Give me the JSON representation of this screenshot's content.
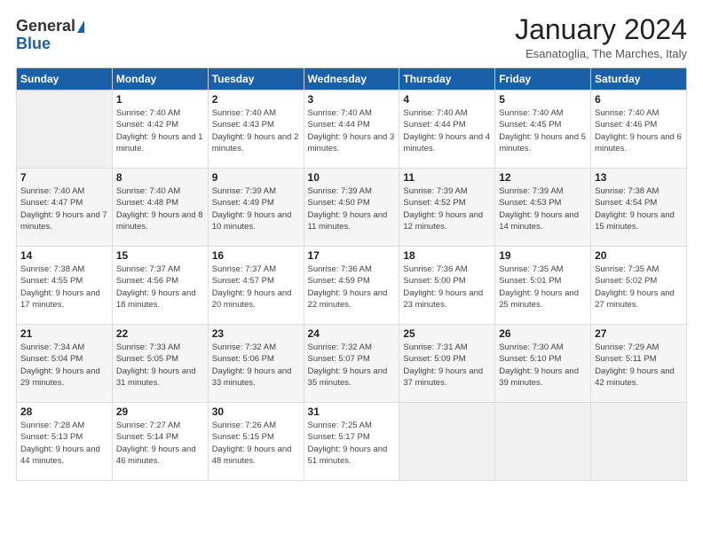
{
  "header": {
    "logo_general": "General",
    "logo_blue": "Blue",
    "month_title": "January 2024",
    "subtitle": "Esanatoglia, The Marches, Italy"
  },
  "days_of_week": [
    "Sunday",
    "Monday",
    "Tuesday",
    "Wednesday",
    "Thursday",
    "Friday",
    "Saturday"
  ],
  "weeks": [
    [
      {
        "num": "",
        "empty": true
      },
      {
        "num": "1",
        "rise": "7:40 AM",
        "set": "4:42 PM",
        "daylight": "9 hours and 1 minute."
      },
      {
        "num": "2",
        "rise": "7:40 AM",
        "set": "4:43 PM",
        "daylight": "9 hours and 2 minutes."
      },
      {
        "num": "3",
        "rise": "7:40 AM",
        "set": "4:44 PM",
        "daylight": "9 hours and 3 minutes."
      },
      {
        "num": "4",
        "rise": "7:40 AM",
        "set": "4:44 PM",
        "daylight": "9 hours and 4 minutes."
      },
      {
        "num": "5",
        "rise": "7:40 AM",
        "set": "4:45 PM",
        "daylight": "9 hours and 5 minutes."
      },
      {
        "num": "6",
        "rise": "7:40 AM",
        "set": "4:46 PM",
        "daylight": "9 hours and 6 minutes."
      }
    ],
    [
      {
        "num": "7",
        "rise": "7:40 AM",
        "set": "4:47 PM",
        "daylight": "9 hours and 7 minutes."
      },
      {
        "num": "8",
        "rise": "7:40 AM",
        "set": "4:48 PM",
        "daylight": "9 hours and 8 minutes."
      },
      {
        "num": "9",
        "rise": "7:39 AM",
        "set": "4:49 PM",
        "daylight": "9 hours and 10 minutes."
      },
      {
        "num": "10",
        "rise": "7:39 AM",
        "set": "4:50 PM",
        "daylight": "9 hours and 11 minutes."
      },
      {
        "num": "11",
        "rise": "7:39 AM",
        "set": "4:52 PM",
        "daylight": "9 hours and 12 minutes."
      },
      {
        "num": "12",
        "rise": "7:39 AM",
        "set": "4:53 PM",
        "daylight": "9 hours and 14 minutes."
      },
      {
        "num": "13",
        "rise": "7:38 AM",
        "set": "4:54 PM",
        "daylight": "9 hours and 15 minutes."
      }
    ],
    [
      {
        "num": "14",
        "rise": "7:38 AM",
        "set": "4:55 PM",
        "daylight": "9 hours and 17 minutes."
      },
      {
        "num": "15",
        "rise": "7:37 AM",
        "set": "4:56 PM",
        "daylight": "9 hours and 18 minutes."
      },
      {
        "num": "16",
        "rise": "7:37 AM",
        "set": "4:57 PM",
        "daylight": "9 hours and 20 minutes."
      },
      {
        "num": "17",
        "rise": "7:36 AM",
        "set": "4:59 PM",
        "daylight": "9 hours and 22 minutes."
      },
      {
        "num": "18",
        "rise": "7:36 AM",
        "set": "5:00 PM",
        "daylight": "9 hours and 23 minutes."
      },
      {
        "num": "19",
        "rise": "7:35 AM",
        "set": "5:01 PM",
        "daylight": "9 hours and 25 minutes."
      },
      {
        "num": "20",
        "rise": "7:35 AM",
        "set": "5:02 PM",
        "daylight": "9 hours and 27 minutes."
      }
    ],
    [
      {
        "num": "21",
        "rise": "7:34 AM",
        "set": "5:04 PM",
        "daylight": "9 hours and 29 minutes."
      },
      {
        "num": "22",
        "rise": "7:33 AM",
        "set": "5:05 PM",
        "daylight": "9 hours and 31 minutes."
      },
      {
        "num": "23",
        "rise": "7:32 AM",
        "set": "5:06 PM",
        "daylight": "9 hours and 33 minutes."
      },
      {
        "num": "24",
        "rise": "7:32 AM",
        "set": "5:07 PM",
        "daylight": "9 hours and 35 minutes."
      },
      {
        "num": "25",
        "rise": "7:31 AM",
        "set": "5:09 PM",
        "daylight": "9 hours and 37 minutes."
      },
      {
        "num": "26",
        "rise": "7:30 AM",
        "set": "5:10 PM",
        "daylight": "9 hours and 39 minutes."
      },
      {
        "num": "27",
        "rise": "7:29 AM",
        "set": "5:11 PM",
        "daylight": "9 hours and 42 minutes."
      }
    ],
    [
      {
        "num": "28",
        "rise": "7:28 AM",
        "set": "5:13 PM",
        "daylight": "9 hours and 44 minutes."
      },
      {
        "num": "29",
        "rise": "7:27 AM",
        "set": "5:14 PM",
        "daylight": "9 hours and 46 minutes."
      },
      {
        "num": "30",
        "rise": "7:26 AM",
        "set": "5:15 PM",
        "daylight": "9 hours and 48 minutes."
      },
      {
        "num": "31",
        "rise": "7:25 AM",
        "set": "5:17 PM",
        "daylight": "9 hours and 51 minutes."
      },
      {
        "num": "",
        "empty": true
      },
      {
        "num": "",
        "empty": true
      },
      {
        "num": "",
        "empty": true
      }
    ]
  ]
}
